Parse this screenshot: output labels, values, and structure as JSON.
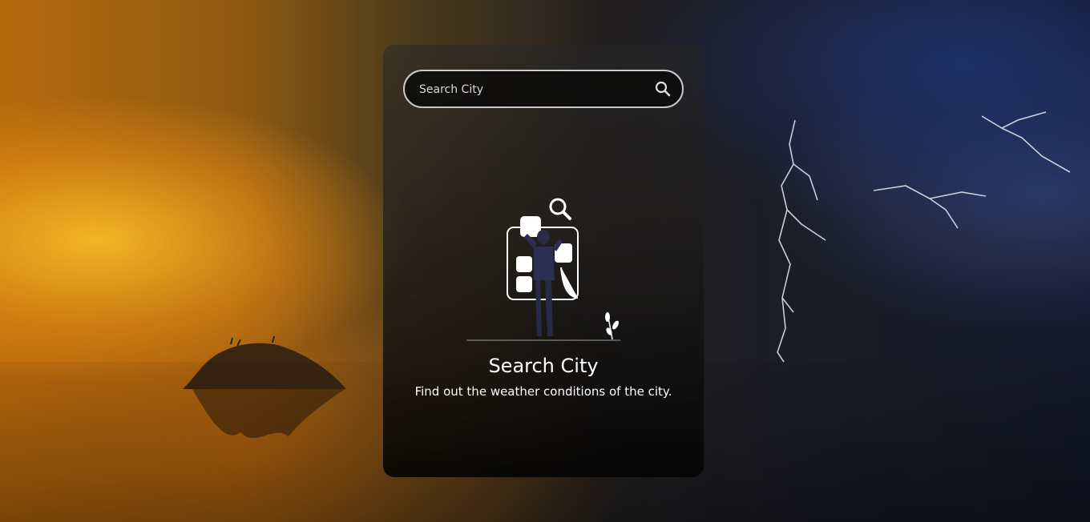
{
  "search": {
    "placeholder": "Search City",
    "button_icon": "search-icon"
  },
  "empty_state": {
    "illustration_icon": "search-city-illustration",
    "title": "Search City",
    "description": "Find out the weather conditions of the city."
  },
  "colors": {
    "card_text": "#ffffff",
    "search_border": "#c9c9c9",
    "illustration_figure": "#2c2f52"
  }
}
